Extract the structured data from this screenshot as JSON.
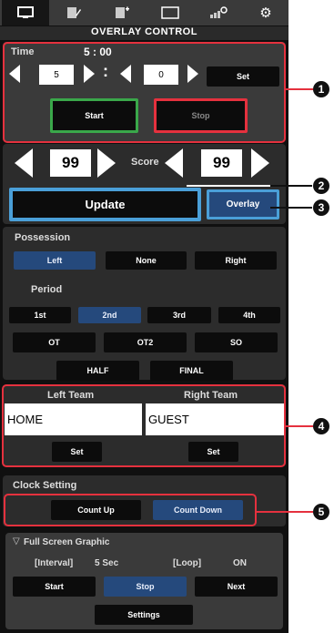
{
  "header": {
    "title": "OVERLAY CONTROL",
    "tabs": [
      {
        "icon": "monitor-icon"
      },
      {
        "icon": "edit-icon"
      },
      {
        "icon": "document-add-icon"
      },
      {
        "icon": "window-icon"
      },
      {
        "icon": "chart-settings-icon"
      },
      {
        "icon": "gear-icon"
      }
    ]
  },
  "time": {
    "label": "Time",
    "value": "5 : 00",
    "minutes": "5",
    "separator": ":",
    "seconds": "0",
    "set_label": "Set",
    "start_label": "Start",
    "stop_label": "Stop"
  },
  "score": {
    "label": "Score",
    "left": "99",
    "right": "99",
    "update_label": "Update",
    "overlay_label": "Overlay"
  },
  "possession": {
    "label": "Possession",
    "options": [
      "Left",
      "None",
      "Right"
    ],
    "selected": "Left"
  },
  "period": {
    "label": "Period",
    "row1": [
      "1st",
      "2nd",
      "3rd",
      "4th"
    ],
    "row2": [
      "OT",
      "OT2",
      "SO"
    ],
    "row3": [
      "HALF",
      "FINAL"
    ],
    "selected": "2nd"
  },
  "teams": {
    "left_label": "Left Team",
    "right_label": "Right Team",
    "left_value": "HOME",
    "right_value": "GUEST",
    "set_label": "Set"
  },
  "clock": {
    "label": "Clock Setting",
    "count_up": "Count Up",
    "count_down": "Count Down",
    "selected": "Count Down"
  },
  "fullscreen": {
    "label": "Full Screen Graphic",
    "interval_label": "[Interval]",
    "interval_value": "5 Sec",
    "loop_label": "[Loop]",
    "loop_value": "ON",
    "start": "Start",
    "stop": "Stop",
    "next": "Next",
    "settings": "Settings"
  },
  "callouts": [
    "1",
    "2",
    "3",
    "4",
    "5"
  ],
  "colors": {
    "accent_blue": "#25497c",
    "highlight_blue": "#4a9fd8",
    "green": "#3aa84a",
    "red": "#e5313e"
  }
}
